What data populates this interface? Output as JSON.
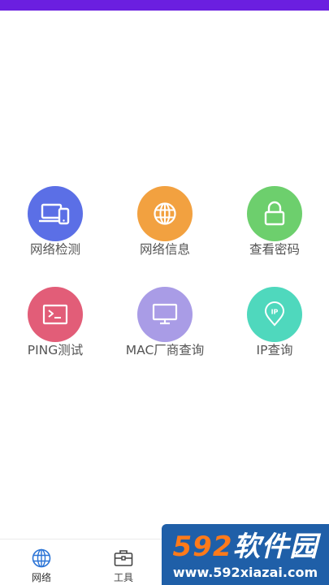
{
  "status_bar": {
    "color": "#6b1fe0"
  },
  "tools": [
    {
      "label": "网络检测",
      "icon": "device-icon",
      "color": "#5b6fe6"
    },
    {
      "label": "网络信息",
      "icon": "globe-icon",
      "color": "#f2a140"
    },
    {
      "label": "查看密码",
      "icon": "lock-icon",
      "color": "#6dcf6d"
    },
    {
      "label": "PING测试",
      "icon": "terminal-icon",
      "color": "#e25d78"
    },
    {
      "label": "MAC厂商查询",
      "icon": "monitor-icon",
      "color": "#a99ce6"
    },
    {
      "label": "IP查询",
      "icon": "ip-pin-icon",
      "color": "#4fd8bd"
    }
  ],
  "bottom_nav": [
    {
      "label": "网络",
      "icon": "globe-icon",
      "active": true,
      "color": "#2a73d6"
    },
    {
      "label": "工具",
      "icon": "toolbox-icon",
      "active": false
    },
    {
      "label": "",
      "icon": "hidden-icon",
      "active": false
    },
    {
      "label": "",
      "icon": "hidden-icon",
      "active": false
    }
  ],
  "watermark": {
    "prefix": "592",
    "name": "软件园",
    "domain": "www.592xiazai.com"
  }
}
